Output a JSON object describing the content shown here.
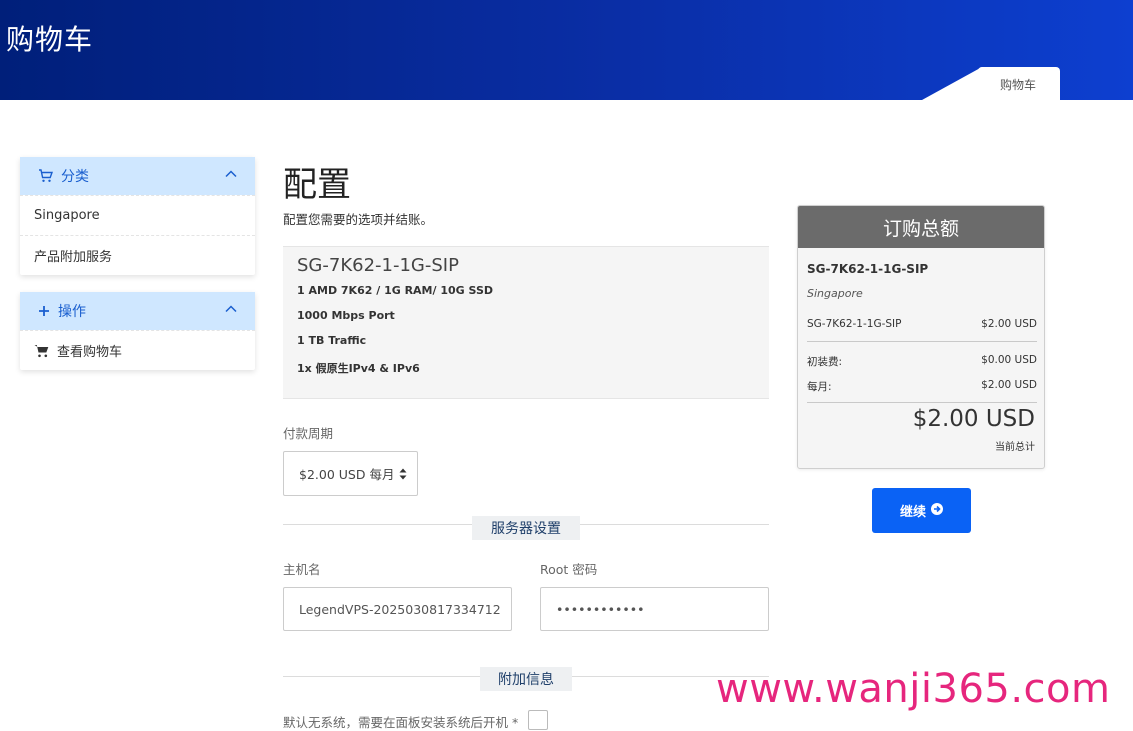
{
  "header": {
    "title": "购物车",
    "breadcrumb": "购物车"
  },
  "sidebar": {
    "categories": {
      "title": "分类",
      "items": [
        "Singapore",
        "产品附加服务"
      ]
    },
    "actions": {
      "title": "操作",
      "items": [
        "查看购物车"
      ]
    }
  },
  "main": {
    "title": "配置",
    "subtitle": "配置您需要的选项并结账。",
    "product": {
      "name": "SG-7K62-1-1G-SIP",
      "specs": [
        "1 AMD 7K62 / 1G RAM/ 10G SSD",
        "1000 Mbps Port",
        "1 TB Traffic",
        "1x 假原生IPv4 & IPv6"
      ]
    },
    "billing_cycle": {
      "label": "付款周期",
      "value": "$2.00 USD 每月"
    },
    "server_settings": {
      "title": "服务器设置",
      "hostname_label": "主机名",
      "hostname_value": "LegendVPS-2025030817334712",
      "root_label": "Root 密码",
      "root_value": "••••••••••••"
    },
    "additional": {
      "title": "附加信息",
      "note": "默认无系统，需要在面板安装系统后开机 *"
    }
  },
  "summary": {
    "title": "订购总额",
    "product": "SG-7K62-1-1G-SIP",
    "group": "Singapore",
    "line_item": {
      "label": "SG-7K62-1-1G-SIP",
      "price": "$2.00 USD"
    },
    "setup": {
      "label": "初装费:",
      "price": "$0.00 USD"
    },
    "monthly": {
      "label": "每月:",
      "price": "$2.00 USD"
    },
    "total": "$2.00 USD",
    "total_label": "当前总计",
    "continue_label": "继续"
  },
  "watermark": "www.wanji365.com",
  "colors": {
    "accent": "#0a62f5",
    "header": "#0a2ea6",
    "panel_head": "#cfe7ff",
    "watermark": "#e6267d"
  }
}
